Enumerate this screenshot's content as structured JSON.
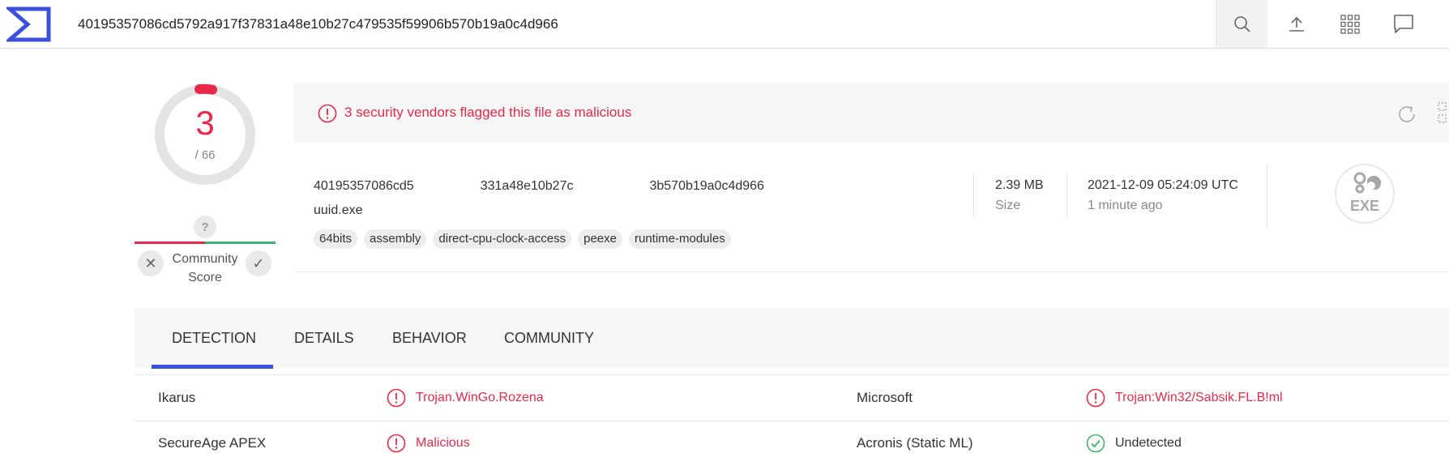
{
  "topbar": {
    "search_value": "40195357086cd5792a917f37831a48e10b27c479535f59906b570b19a0c4d966",
    "icons": [
      "logo-icon",
      "search-icon",
      "upload-icon",
      "grid-icon",
      "chat-icon"
    ]
  },
  "score": {
    "positives": "3",
    "total": "/ 66",
    "community_question": "?",
    "community_label_line1": "Community",
    "community_label_line2": "Score",
    "vote_down": "✕",
    "vote_up": "✓"
  },
  "alert": {
    "icon": "!",
    "text": "3 security vendors flagged this file as malicious"
  },
  "file": {
    "hash_part1": "40195357086cd5",
    "hash_part2": "331a48e10b27c",
    "hash_part3": "3b570b19a0c4d966",
    "name": "uuid.exe",
    "tags": [
      "64bits",
      "assembly",
      "direct-cpu-clock-access",
      "peexe",
      "runtime-modules"
    ],
    "size_value": "2.39 MB",
    "size_label": "Size",
    "date_value": "2021-12-09 05:24:09 UTC",
    "date_ago": "1 minute ago",
    "type_label": "EXE"
  },
  "tabs": [
    {
      "label": "DETECTION",
      "active": true
    },
    {
      "label": "DETAILS",
      "active": false
    },
    {
      "label": "BEHAVIOR",
      "active": false
    },
    {
      "label": "COMMUNITY",
      "active": false
    }
  ],
  "detections": [
    {
      "left_vendor": "Ikarus",
      "left_result": "Trojan.WinGo.Rozena",
      "left_status": "malicious",
      "right_vendor": "Microsoft",
      "right_result": "Trojan:Win32/Sabsik.FL.B!ml",
      "right_status": "malicious"
    },
    {
      "left_vendor": "SecureAge APEX",
      "left_result": "Malicious",
      "left_status": "malicious",
      "right_vendor": "Acronis (Static ML)",
      "right_result": "Undetected",
      "right_status": "undetected"
    }
  ],
  "colors": {
    "malicious": "#e8294a",
    "undetected": "#3cb371",
    "accent": "#3b50dd"
  }
}
